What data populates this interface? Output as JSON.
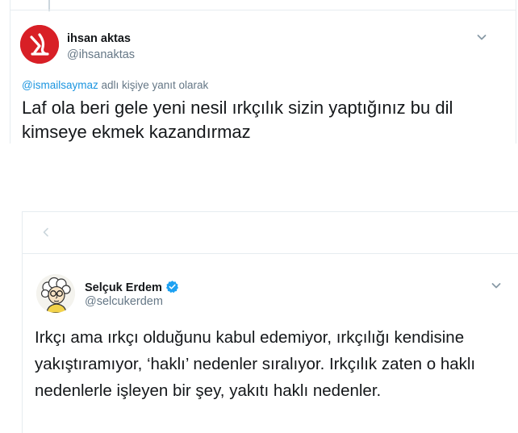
{
  "tweet_top": {
    "author_name": "ihsan aktas",
    "author_handle": "@ihsanaktas",
    "reply_mention": "@ismailsaymaz",
    "reply_suffix": " adlı kişiye yanıt olarak",
    "text": "Laf ola beri gele yeni nesil ırkçılık sizin yaptığınız bu dil kimseye ekmek kazandırmaz",
    "avatar_color": "#d81f26"
  },
  "tweet_bottom": {
    "author_name": "Selçuk Erdem",
    "author_handle": "@selcukerdem",
    "verified": true,
    "text": "Irkçı ama ırkçı olduğunu kabul edemiyor, ırkçılığı kendisine yakıştıramıyor, ‘haklı’ nedenler sıralıyor. Irkçılık zaten o haklı nedenlerle işleyen bir şey, yakıtı haklı nedenler.",
    "verified_color": "#1da1f2"
  },
  "icons": {
    "menu": "chevron-down-icon",
    "back": "back-arrow-icon",
    "verified": "verified-badge-icon"
  }
}
